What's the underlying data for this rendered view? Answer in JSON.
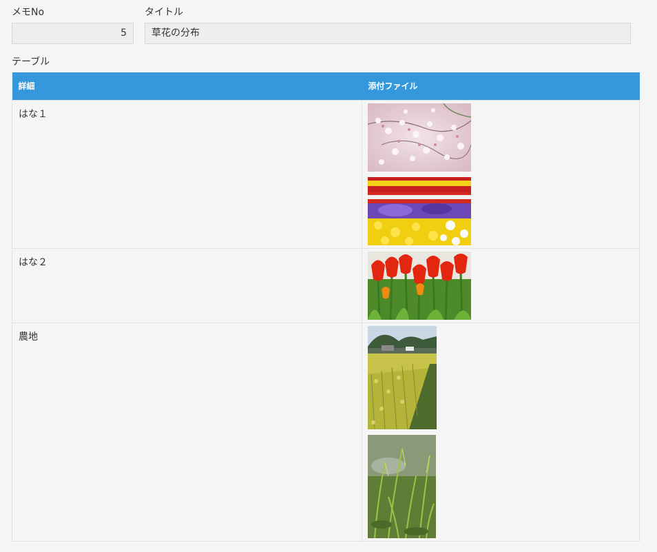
{
  "fields": {
    "memo_no": {
      "label": "メモNo",
      "value": "5"
    },
    "title": {
      "label": "タイトル",
      "value": "草花の分布"
    }
  },
  "table": {
    "label": "テーブル",
    "headers": [
      "詳細",
      "添付ファイル"
    ],
    "rows": [
      {
        "detail": "はな１",
        "attachments": [
          {
            "icon": "cherry-blossom-photo"
          },
          {
            "icon": "flower-bed-photo"
          }
        ]
      },
      {
        "detail": "はな２",
        "attachments": [
          {
            "icon": "tulips-photo"
          }
        ]
      },
      {
        "detail": "農地",
        "attachments": [
          {
            "icon": "rice-field-photo"
          },
          {
            "icon": "grass-photo"
          }
        ]
      }
    ]
  },
  "colors": {
    "header_bg": "#3498db",
    "page_bg": "#f5f5f5",
    "field_bg": "#eeeeee"
  }
}
